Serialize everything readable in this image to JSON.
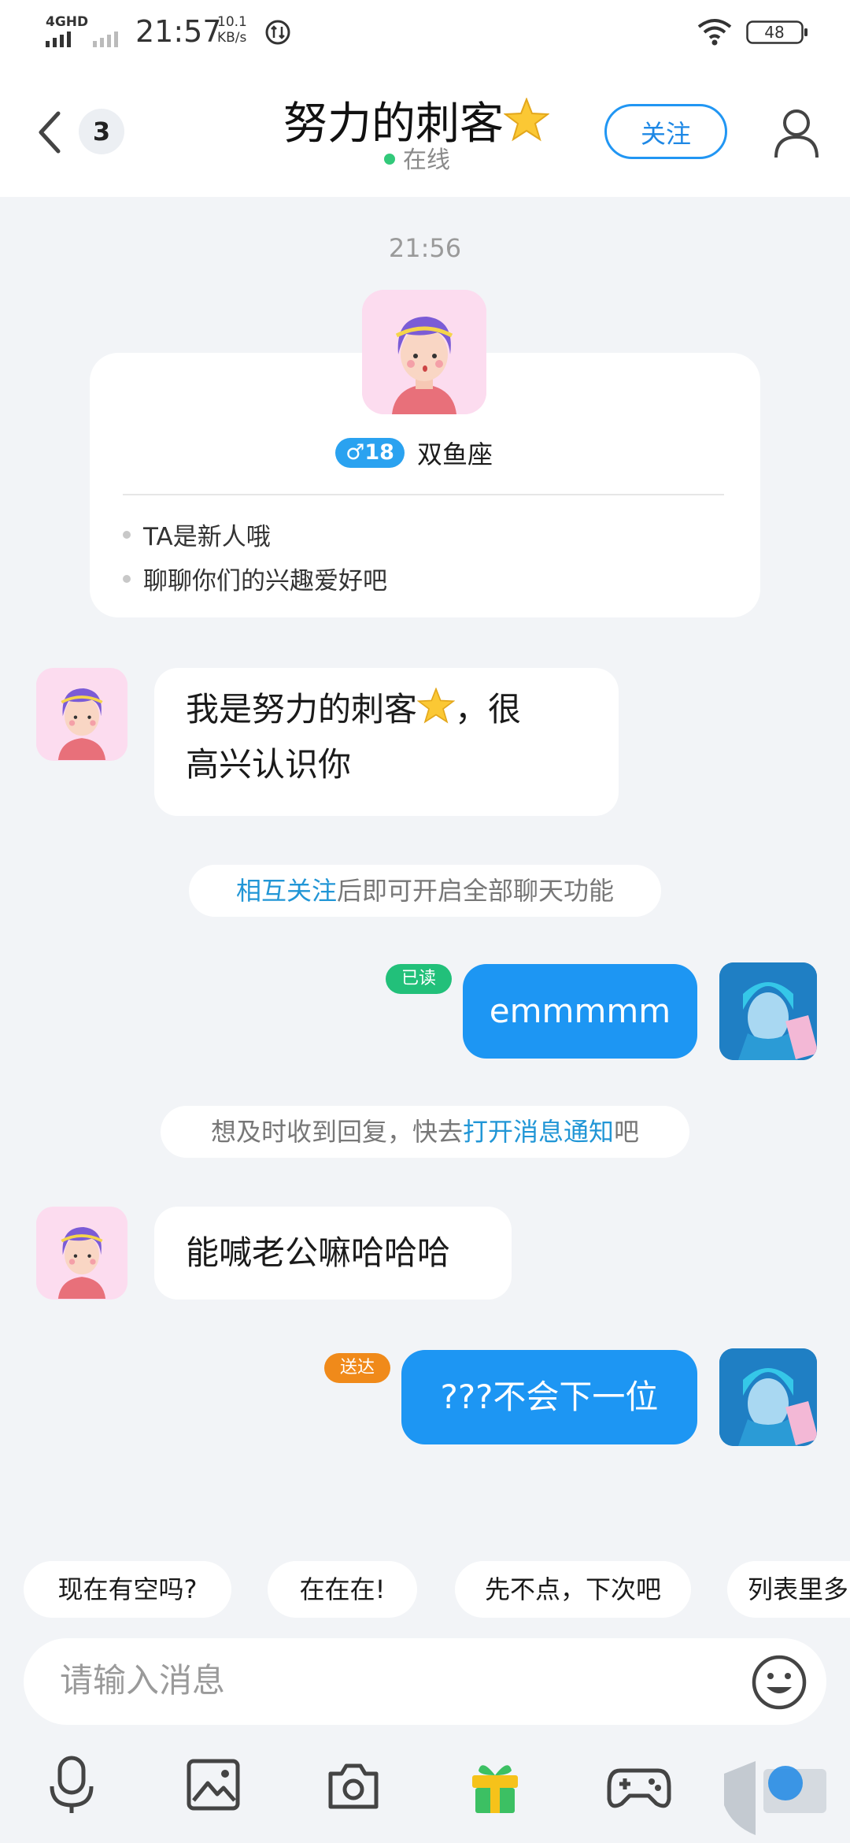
{
  "status_bar": {
    "network": "4GHD",
    "time": "21:57",
    "speed_value": "10.1",
    "speed_unit": "KB/s",
    "battery": "48"
  },
  "header": {
    "title": "努力的刺客",
    "title_icon": "star-icon",
    "unread_count": "3",
    "status_text": "在线",
    "follow_label": "关注"
  },
  "time_separator": "21:56",
  "profile_card": {
    "gender_age": "♂18",
    "zodiac": "双鱼座",
    "tips": [
      "TA是新人哦",
      "聊聊你们的兴趣爱好吧"
    ]
  },
  "messages": {
    "m1_line1": "我是努力的刺客",
    "m1_line1_end": "，很",
    "m1_line2": "高兴认识你",
    "note1_link": "相互关注",
    "note1_rest": "后即可开启全部聊天功能",
    "m2_text": "emmmmm",
    "m2_status": "已读",
    "note2_pre": "想及时收到回复，快去",
    "note2_link": "打开消息通知",
    "note2_post": "吧",
    "m3_text": "能喊老公嘛哈哈哈",
    "m4_text": "???不会下一位",
    "m4_status": "送达"
  },
  "quick_replies": [
    "现在有空吗?",
    "在在在!",
    "先不点，下次吧",
    "列表里多"
  ],
  "input": {
    "placeholder": "请输入消息"
  },
  "toolbar": [
    "microphone-icon",
    "image-icon",
    "camera-icon",
    "gift-icon",
    "game-icon"
  ],
  "colors": {
    "accent": "#1d96f3",
    "online": "#32c97a",
    "read": "#22c07a",
    "sent": "#f08a1a"
  }
}
